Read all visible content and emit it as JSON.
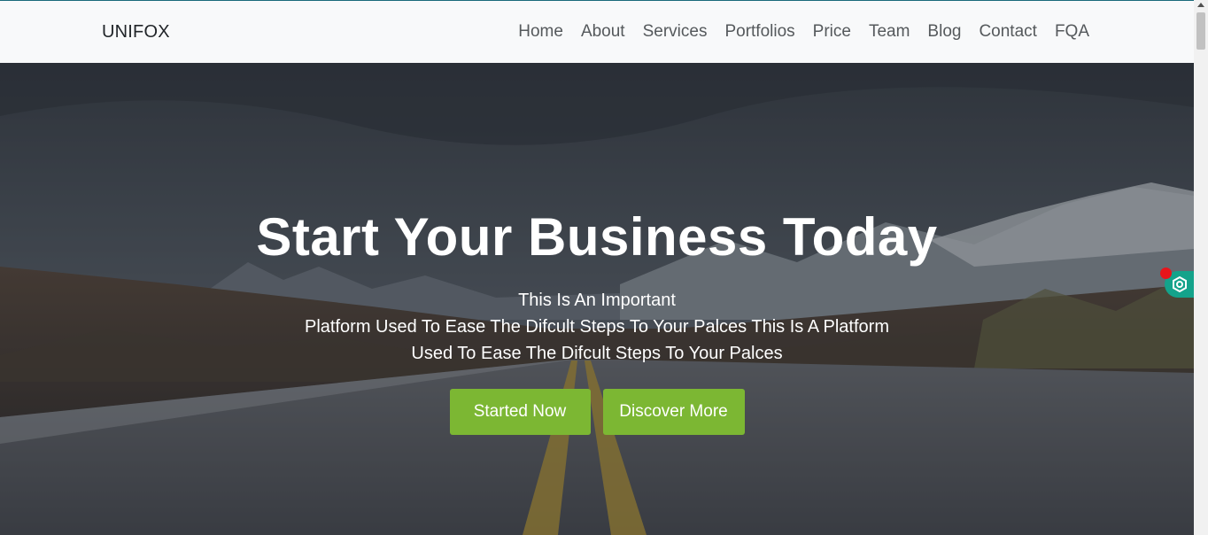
{
  "navbar": {
    "brand": "UNIFOX",
    "links": [
      "Home",
      "About",
      "Services",
      "Portfolios",
      "Price",
      "Team",
      "Blog",
      "Contact",
      "FQA"
    ]
  },
  "hero": {
    "title": "Start Your Business Today",
    "subtitle_lines": [
      "This Is An Important",
      "Platform Used To Ease The Difcult Steps To Your Palces This Is A Platform",
      "Used To Ease The Difcult Steps To Your Palces"
    ],
    "buttons": {
      "started": "Started Now",
      "discover": "Discover More"
    }
  },
  "colors": {
    "accent": "#7cb733",
    "navbar_bg": "#f8f9fa",
    "extension": "#14a38b"
  },
  "icons": {
    "extension": "hexagon-extension-icon"
  }
}
